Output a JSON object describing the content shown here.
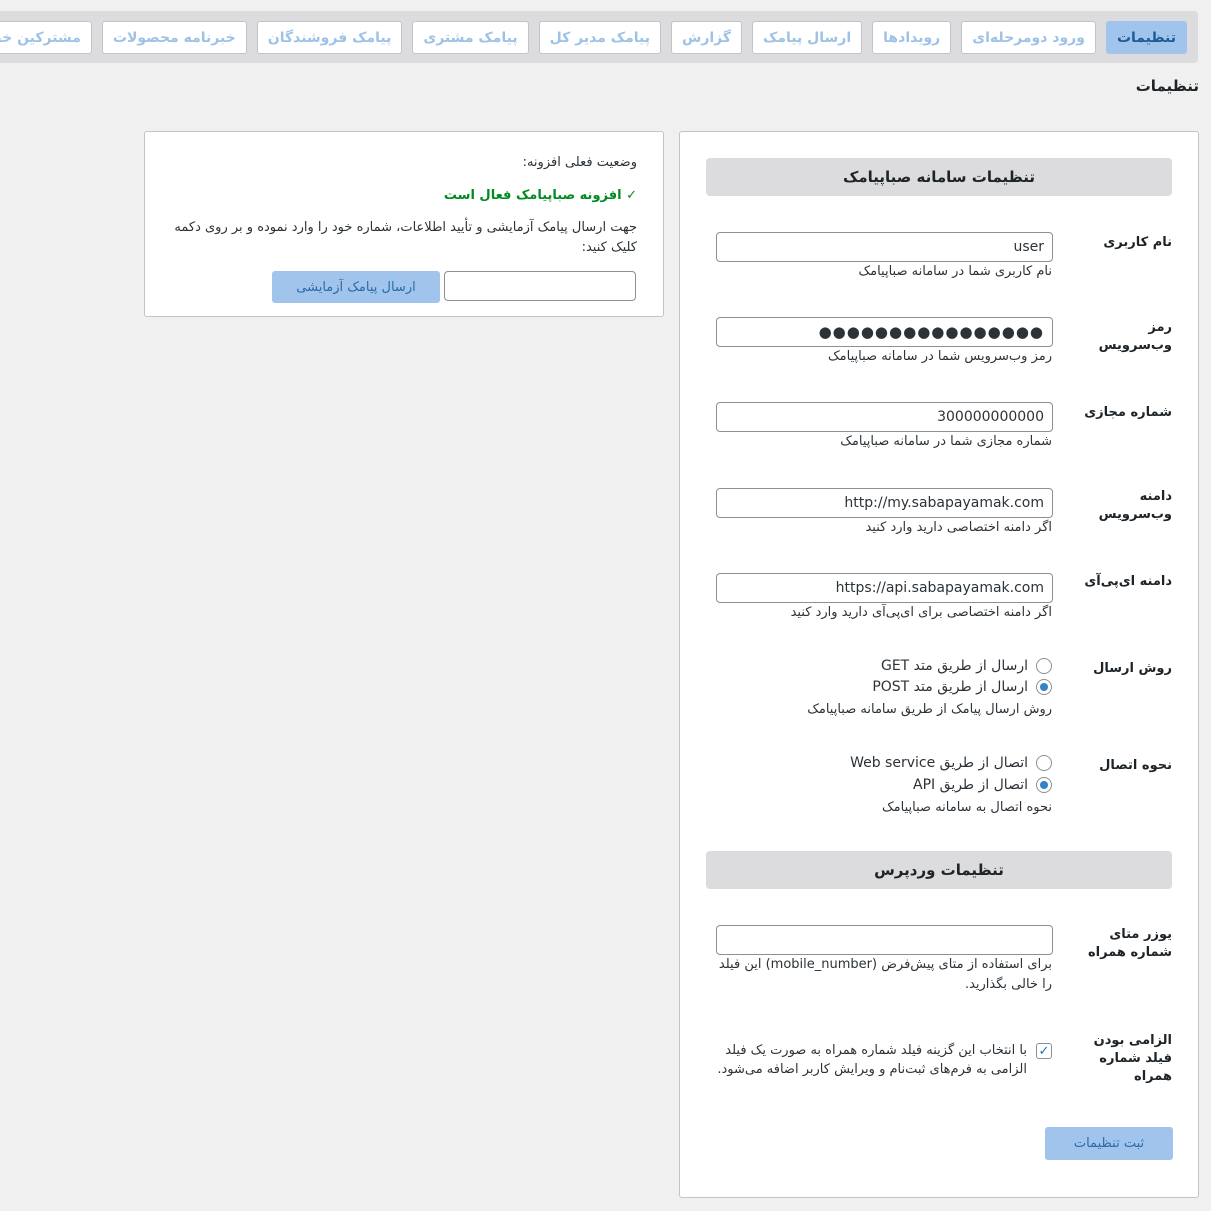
{
  "tabs": [
    {
      "label": "تنظیمات",
      "active": true
    },
    {
      "label": "ورود دومرحله‌ای",
      "active": false
    },
    {
      "label": "رویدادها",
      "active": false
    },
    {
      "label": "ارسال پیامک",
      "active": false
    },
    {
      "label": "گزارش",
      "active": false
    },
    {
      "label": "پیامک مدیر کل",
      "active": false
    },
    {
      "label": "پیامک مشتری",
      "active": false
    },
    {
      "label": "پیامک فروشندگان",
      "active": false
    },
    {
      "label": "خبرنامه محصولات",
      "active": false
    },
    {
      "label": "مشترکین خبرنامه",
      "active": false
    }
  ],
  "page_title": "تنظیمات",
  "settings": {
    "section_sms": "تنظیمات سامانه صباپیامک",
    "username": {
      "label": "نام کاربری",
      "value": "user",
      "desc": "نام کاربری شما در سامانه صباپیامک"
    },
    "password": {
      "label": "رمز وب‌سرویس",
      "value": "●●●●●●●●●●●●●●●●",
      "desc": "رمز وب‌سرویس شما در سامانه صباپیامک"
    },
    "virtual_number": {
      "label": "شماره مجازی",
      "value": "300000000000",
      "desc": "شماره مجازی شما در سامانه صباپیامک"
    },
    "ws_domain": {
      "label": "دامنه وب‌سرویس",
      "value": "http://my.sabapayamak.com",
      "desc": "اگر دامنه اختصاصی دارید وارد کنید"
    },
    "api_domain": {
      "label": "دامنه ای‌پی‌آی",
      "value": "https://api.sabapayamak.com",
      "desc": "اگر دامنه اختصاصی برای ای‌پی‌آی دارید وارد کنید"
    },
    "send_method": {
      "label": "روش ارسال",
      "options": [
        "ارسال از طریق متد GET",
        "ارسال از طریق متد POST"
      ],
      "selected": 1,
      "desc": "روش ارسال پیامک از طریق سامانه صباپیامک"
    },
    "connection": {
      "label": "نحوه اتصال",
      "options": [
        "اتصال از طریق Web service",
        "اتصال از طریق API"
      ],
      "selected": 1,
      "desc": "نحوه اتصال به سامانه صباپیامک"
    },
    "section_wp": "تنظیمات وردپرس",
    "user_meta": {
      "label": "یوزر متای شماره همراه",
      "value": "",
      "desc": "برای استفاده از متای پیش‌فرض (mobile_number) این فیلد را خالی بگذارید."
    },
    "mobile_required": {
      "label": "الزامی بودن فیلد شماره همراه",
      "checked": true,
      "text": "با انتخاب این گزینه فیلد شماره همراه به صورت یک فیلد الزامی به فرم‌های ثبت‌نام و ویرایش کاربر اضافه می‌شود."
    },
    "save_label": "ثبت تنظیمات"
  },
  "status": {
    "title": "وضعیت فعلی افزونه:",
    "ok_text": "✓ افزونه صباپیامک فعال است",
    "instruction": "جهت ارسال پیامک آزمایشی و تأیید اطلاعات، شماره خود را وارد نموده و بر روی دکمه کلیک کنید:",
    "test_value": "",
    "test_button": "ارسال پیامک آزمایشی"
  }
}
